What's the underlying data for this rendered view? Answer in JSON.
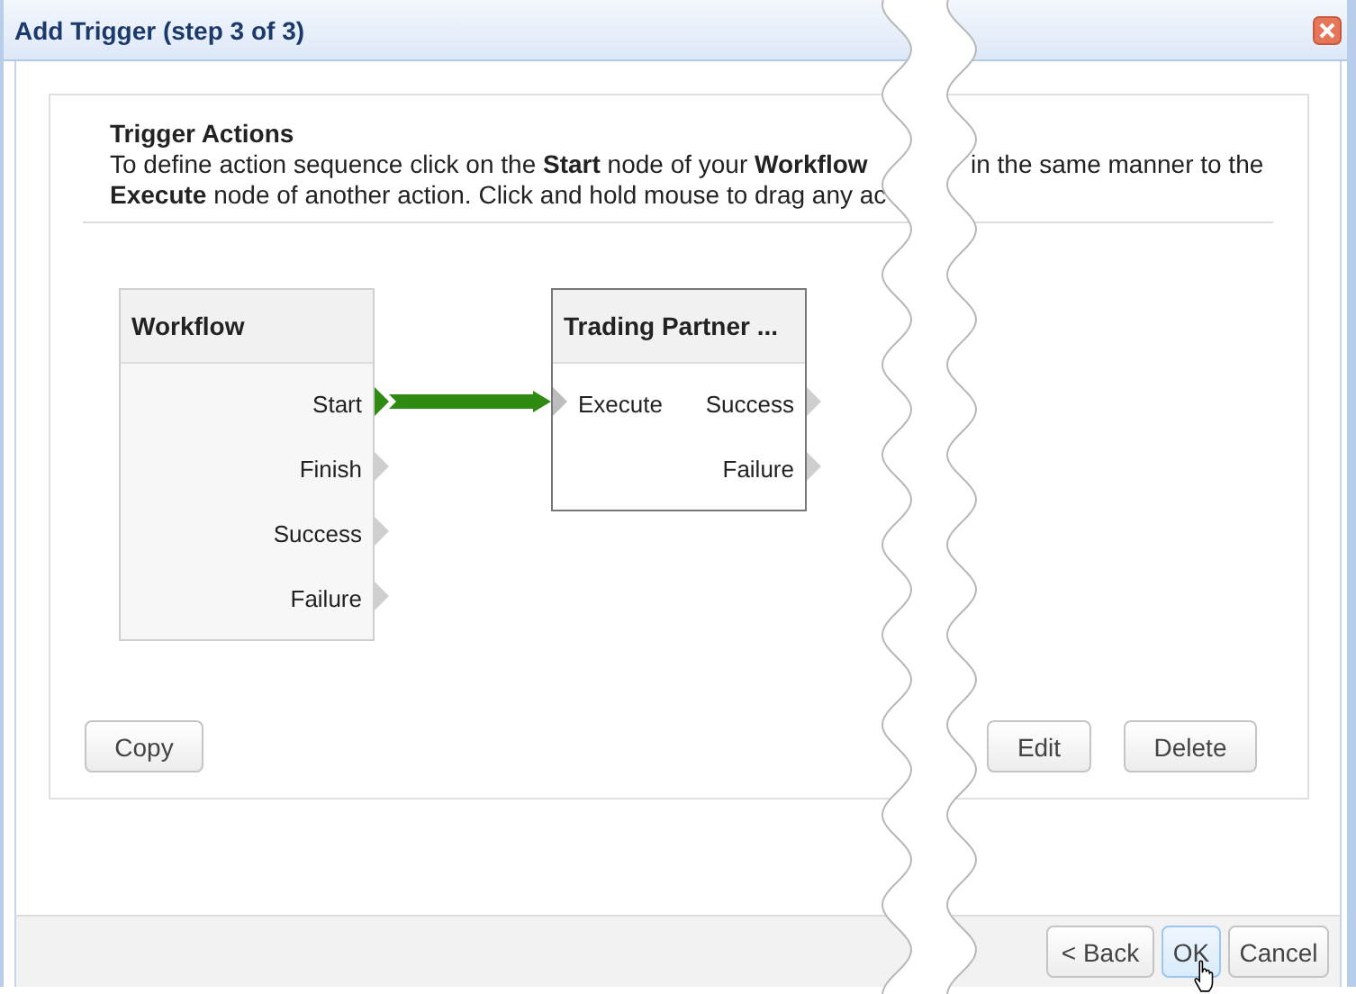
{
  "window": {
    "title": "Add Trigger (step 3 of 3)"
  },
  "section": {
    "heading": "Trigger Actions",
    "text_left": [
      "To define action sequence click on the **Start** node of your **Workflow**",
      "**Execute** node of another action. Click and hold mouse to drag any ac"
    ],
    "text_right": [
      "in the same manner to the"
    ]
  },
  "diagram": {
    "nodes": [
      {
        "title": "Workflow",
        "selected": false,
        "rows": [
          {
            "output": "Start",
            "output_connected": true
          },
          {
            "output": "Finish",
            "output_connected": false
          },
          {
            "output": "Success",
            "output_connected": false
          },
          {
            "output": "Failure",
            "output_connected": false
          }
        ]
      },
      {
        "title": "Trading Partner ...",
        "selected": true,
        "rows": [
          {
            "input": "Execute",
            "input_connected": true,
            "output": "Success",
            "output_connected": false
          },
          {
            "output": "Failure",
            "output_connected": false
          }
        ]
      }
    ]
  },
  "left_buttons": [
    "Copy"
  ],
  "right_buttons": [
    "Edit",
    "Delete"
  ],
  "footer_buttons": [
    {
      "label": "< Back",
      "highlighted": false
    },
    {
      "label": "OK",
      "highlighted": true
    },
    {
      "label": "Cancel",
      "highlighted": false
    }
  ]
}
